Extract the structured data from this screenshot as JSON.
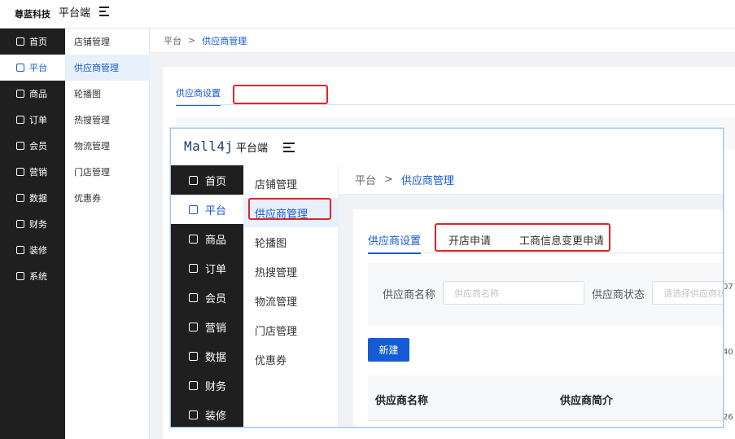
{
  "outer": {
    "brand": "尊蓝科技",
    "title": "平台端",
    "side_menu": [
      "首页",
      "平台",
      "商品",
      "订单",
      "会员",
      "营销",
      "数据",
      "财务",
      "装修",
      "系统"
    ],
    "sub_menu": [
      "店铺管理",
      "供应商管理",
      "轮播图",
      "热搜管理",
      "物流管理",
      "门店管理",
      "优惠券"
    ],
    "breadcrumb": {
      "root": "平台",
      "separator": ">",
      "current": "供应商管理"
    },
    "tab": "供应商设置",
    "edge_numbers": [
      "07",
      "40",
      "26"
    ]
  },
  "inner": {
    "logo": "Mall4j",
    "title": "平台端",
    "side_menu": [
      "首页",
      "平台",
      "商品",
      "订单",
      "会员",
      "营销",
      "数据",
      "财务",
      "装修"
    ],
    "sub_menu": [
      "店铺管理",
      "供应商管理",
      "轮播图",
      "热搜管理",
      "物流管理",
      "门店管理",
      "优惠券"
    ],
    "breadcrumb": {
      "root": "平台",
      "separator": ">",
      "current": "供应商管理"
    },
    "tabs": [
      "供应商设置",
      "开店申请",
      "工商信息变更申请"
    ],
    "filter": {
      "name_label": "供应商名称",
      "name_placeholder": "供应商名称",
      "status_label": "供应商状态",
      "status_placeholder": "请选择供应商状态"
    },
    "new_button": "新建",
    "table_headers": [
      "供应商名称",
      "供应商简介"
    ]
  },
  "colors": {
    "accent": "#155bd4",
    "sidebar": "#1f1f1f",
    "highlight_box": "#e0242a"
  }
}
